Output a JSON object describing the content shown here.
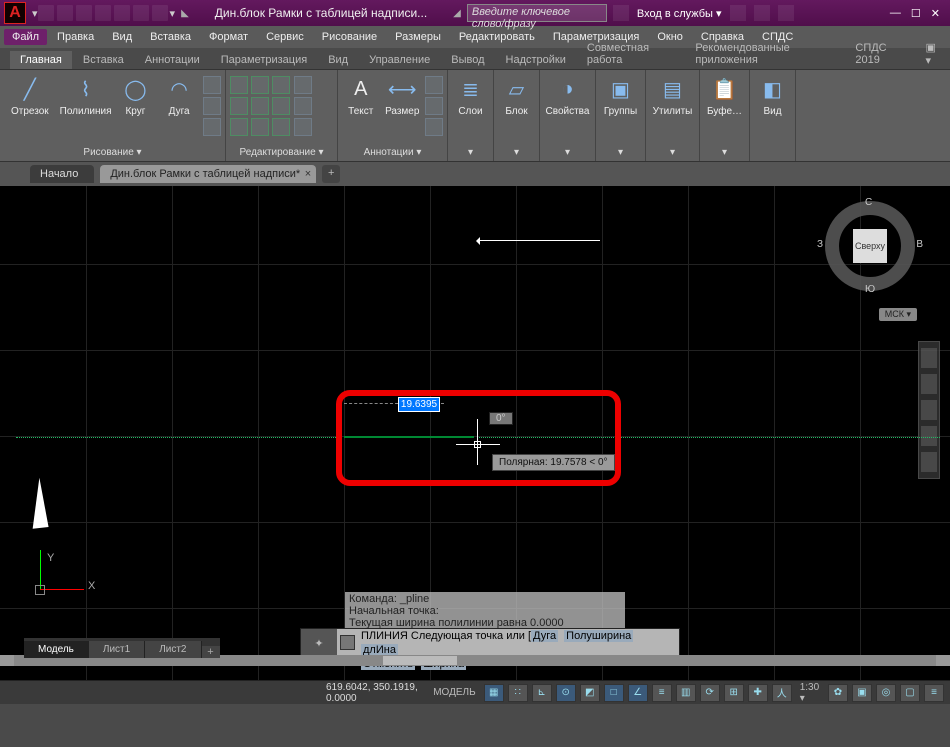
{
  "title": "Дин.блок Рамки с таблицей надписи...",
  "search_placeholder": "Введите ключевое слово/фразу",
  "login_label": "Вход в службы",
  "menubar": [
    "Файл",
    "Правка",
    "Вид",
    "Вставка",
    "Формат",
    "Сервис",
    "Рисование",
    "Размеры",
    "Редактировать",
    "Параметризация",
    "Окно",
    "Справка",
    "СПДС"
  ],
  "ribbon_tabs": [
    "Главная",
    "Вставка",
    "Аннотации",
    "Параметризация",
    "Вид",
    "Управление",
    "Вывод",
    "Надстройки",
    "Совместная работа",
    "Рекомендованные приложения",
    "СПДС 2019"
  ],
  "panels": {
    "draw": {
      "title": "Рисование ▾",
      "btns": [
        "Отрезок",
        "Полилиния",
        "Круг",
        "Дуга"
      ]
    },
    "modify": {
      "title": "Редактирование ▾"
    },
    "annot": {
      "title": "Аннотации ▾",
      "btns": [
        "Текст",
        "Размер"
      ]
    },
    "layers": {
      "title": "Слои",
      "btn": "Слои"
    },
    "block": {
      "title": "Блок",
      "btn": "Блок"
    },
    "props": {
      "title": "Свойства",
      "btn": "Свойства"
    },
    "groups": {
      "title": "Группы",
      "btn": "Группы"
    },
    "util": {
      "title": "Утилиты",
      "btn": "Утилиты"
    },
    "clip": {
      "title": "Буфе…",
      "btn": "Буфе…"
    },
    "view": {
      "title": "Вид",
      "btn": "Вид"
    }
  },
  "dtabs": {
    "start": "Начало",
    "current": "Дин.блок Рамки с таблицей надписи*"
  },
  "viewcube": {
    "top": "Сверху",
    "n": "С",
    "s": "Ю",
    "e": "В",
    "w": "З",
    "cs": "МСК ▾"
  },
  "ucs": {
    "x": "X",
    "y": "Y"
  },
  "dyn_input": {
    "len": "19.6395",
    "ang": "0°",
    "polar": "Полярная: 19.7578 < 0°"
  },
  "cmd_history": [
    "Команда: _pline",
    "Начальная точка:",
    "Текущая ширина полилинии равна 0.0000"
  ],
  "cmd_line": {
    "main": "ПЛИНИЯ Следующая точка или [",
    "k1": "Дуга",
    "k2": "Полуширина",
    "k3": "длИна",
    "mid": " ",
    "k4": "Отменить",
    "k5": "Ширина",
    "tail": "]:"
  },
  "layouts": [
    "Модель",
    "Лист1",
    "Лист2"
  ],
  "status": {
    "coords": "619.6042, 350.1919, 0.0000",
    "space": "МОДЕЛЬ",
    "scale": "1:30 ▾"
  }
}
